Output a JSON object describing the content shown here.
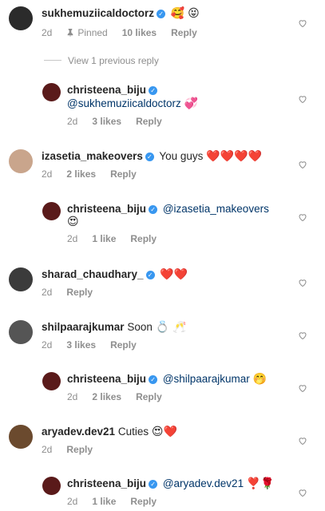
{
  "view_previous": "View 1 previous reply",
  "comments": [
    {
      "username": "sukhemuziicaldoctorz",
      "verified": true,
      "text": "",
      "emoji": "🥰 😝",
      "time": "2d",
      "pinned": "Pinned",
      "likes": "10 likes",
      "reply": "Reply",
      "avatar_color": "#2b2b2b"
    },
    {
      "username": "christeena_biju",
      "verified": true,
      "mention": "@sukhemuziicaldoctorz",
      "text": "",
      "emoji": "💞",
      "time": "2d",
      "likes": "3 likes",
      "reply": "Reply",
      "avatar_color": "#5a1a1a"
    },
    {
      "username": "izasetia_makeovers",
      "verified": true,
      "text": "You guys",
      "emoji": "❤️❤️❤️❤️",
      "time": "2d",
      "likes": "2 likes",
      "reply": "Reply",
      "avatar_color": "#c9a58c"
    },
    {
      "username": "christeena_biju",
      "verified": true,
      "mention": "@izasetia_makeovers",
      "text": "",
      "emoji": "😍",
      "time": "2d",
      "likes": "1 like",
      "reply": "Reply",
      "avatar_color": "#5a1a1a"
    },
    {
      "username": "sharad_chaudhary_",
      "verified": true,
      "text": "",
      "emoji": "❤️❤️",
      "time": "2d",
      "likes": "",
      "reply": "Reply",
      "avatar_color": "#3b3b3b"
    },
    {
      "username": "shilpaarajkumar",
      "verified": false,
      "text": "Soon",
      "emoji": "💍 🥂",
      "time": "2d",
      "likes": "3 likes",
      "reply": "Reply",
      "avatar_color": "#555555"
    },
    {
      "username": "christeena_biju",
      "verified": true,
      "mention": "@shilpaarajkumar",
      "text": "",
      "emoji": "🤭",
      "time": "2d",
      "likes": "2 likes",
      "reply": "Reply",
      "avatar_color": "#5a1a1a"
    },
    {
      "username": "aryadev.dev21",
      "verified": false,
      "text": "Cuties",
      "emoji": "😍❤️",
      "time": "2d",
      "likes": "",
      "reply": "Reply",
      "avatar_color": "#6b4a2e"
    },
    {
      "username": "christeena_biju",
      "verified": true,
      "mention": "@aryadev.dev21",
      "text": "",
      "emoji": "❣️🌹",
      "time": "2d",
      "likes": "1 like",
      "reply": "Reply",
      "avatar_color": "#5a1a1a"
    }
  ]
}
